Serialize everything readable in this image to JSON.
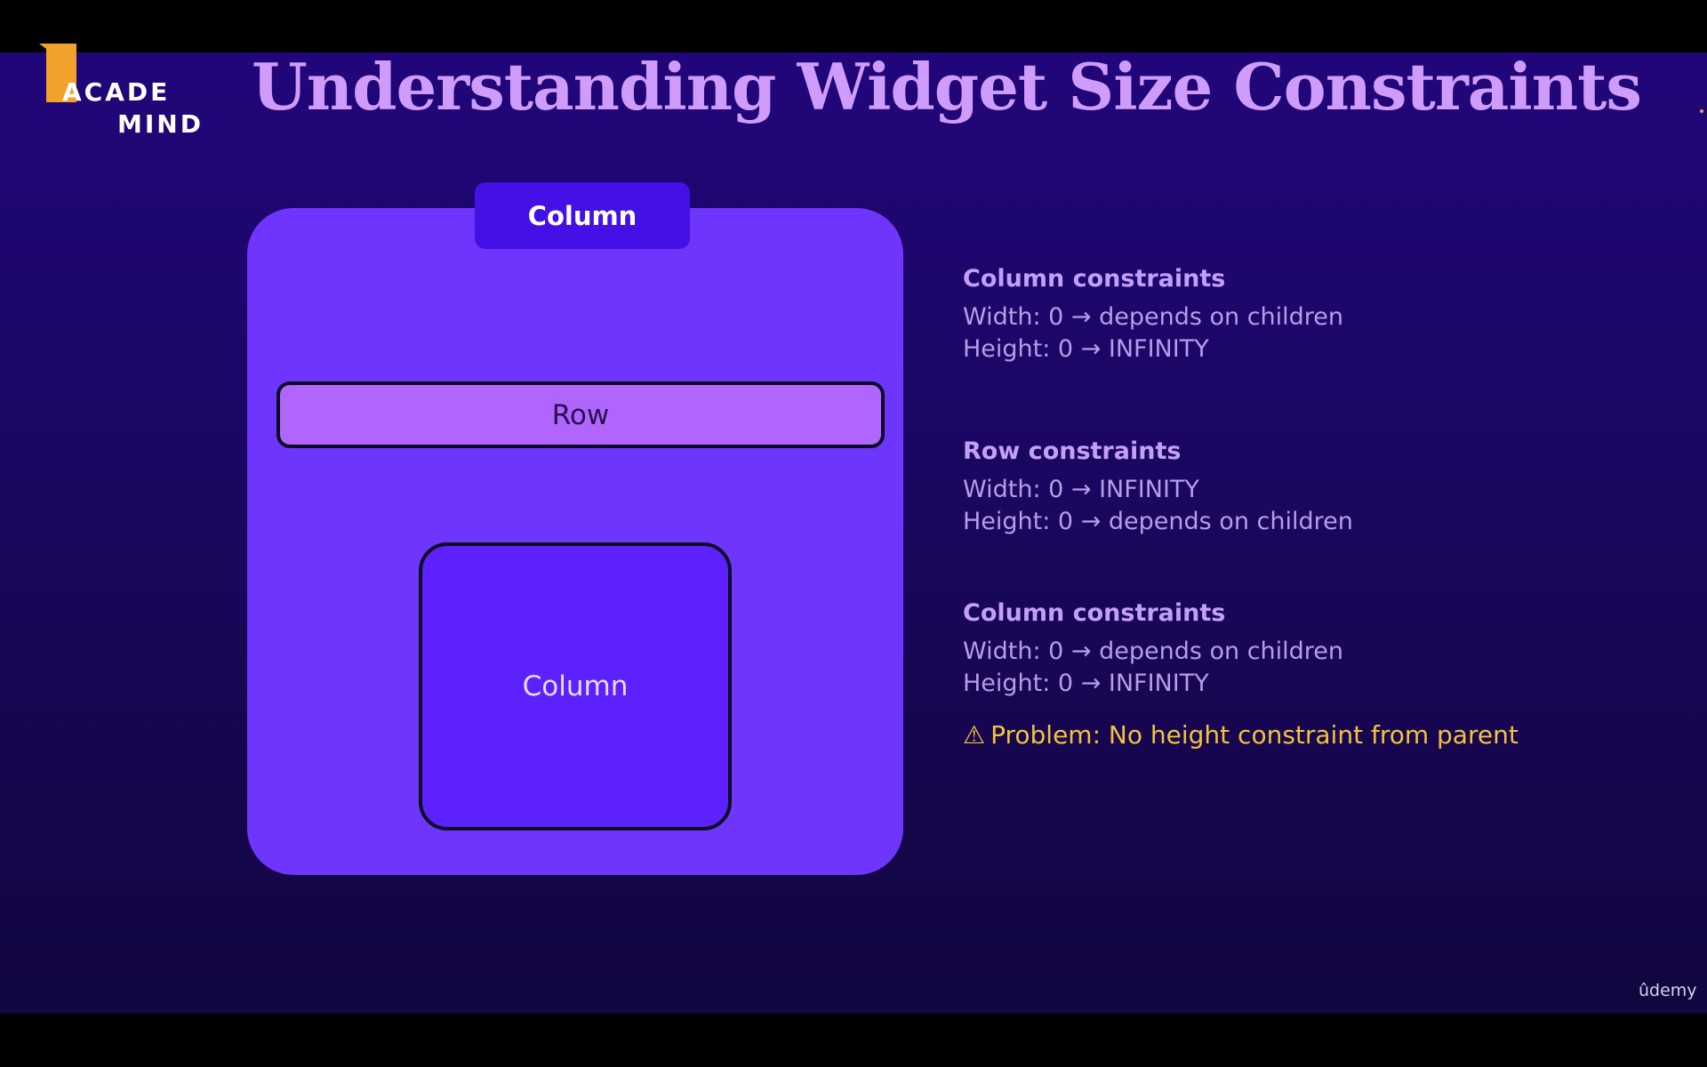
{
  "logo": {
    "line1": "ACADE",
    "line2": "MIND"
  },
  "title": "Understanding Widget Size Constraints",
  "diagram": {
    "outer_label": "Column",
    "row_label": "Row",
    "inner_label": "Column"
  },
  "constraints": [
    {
      "heading": "Column constraints",
      "width": "Width: 0 → depends on children",
      "height": "Height: 0 → INFINITY"
    },
    {
      "heading": "Row constraints",
      "width": "Width: 0 → INFINITY",
      "height": "Height: 0 → depends on children"
    },
    {
      "heading": "Column constraints",
      "width": "Width: 0 → depends on children",
      "height": "Height: 0 → INFINITY"
    }
  ],
  "warning": {
    "icon": "warning-icon",
    "text": "Problem: No height constraint from parent"
  },
  "watermark": "ûdemy"
}
